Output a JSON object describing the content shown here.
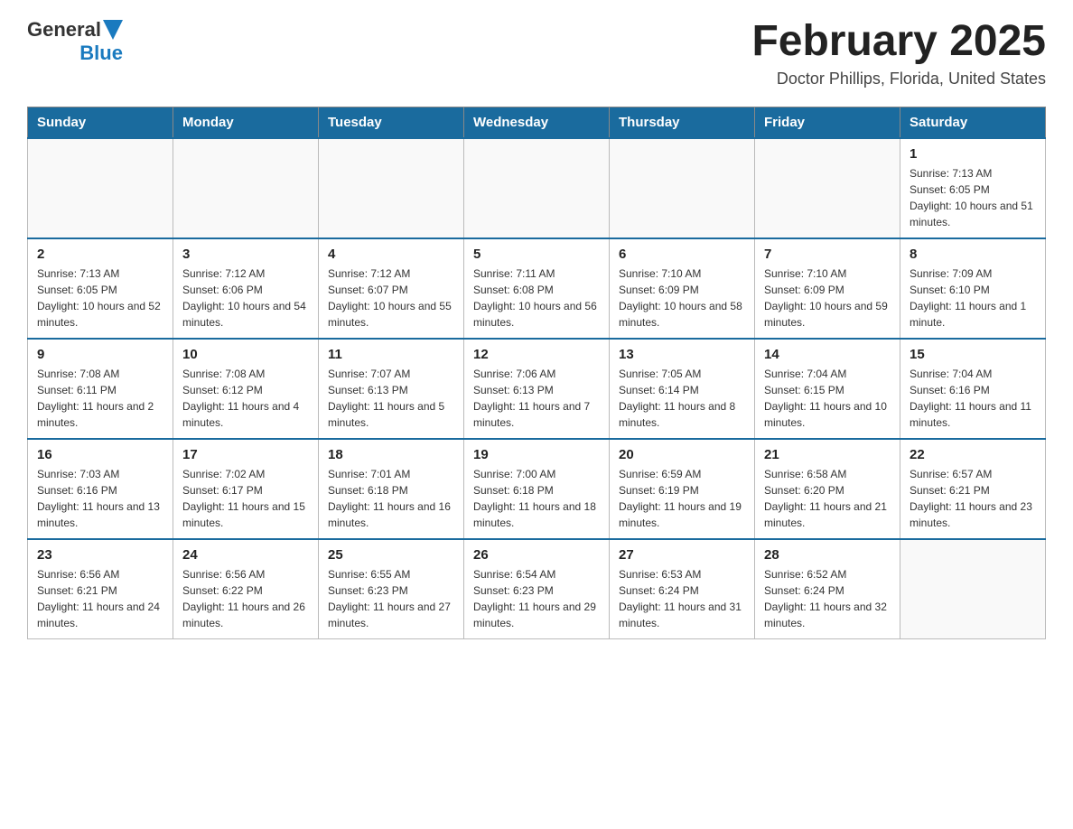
{
  "logo": {
    "general": "General",
    "blue": "Blue"
  },
  "header": {
    "month": "February 2025",
    "location": "Doctor Phillips, Florida, United States"
  },
  "weekdays": [
    "Sunday",
    "Monday",
    "Tuesday",
    "Wednesday",
    "Thursday",
    "Friday",
    "Saturday"
  ],
  "weeks": [
    [
      {
        "day": "",
        "sunrise": "",
        "sunset": "",
        "daylight": ""
      },
      {
        "day": "",
        "sunrise": "",
        "sunset": "",
        "daylight": ""
      },
      {
        "day": "",
        "sunrise": "",
        "sunset": "",
        "daylight": ""
      },
      {
        "day": "",
        "sunrise": "",
        "sunset": "",
        "daylight": ""
      },
      {
        "day": "",
        "sunrise": "",
        "sunset": "",
        "daylight": ""
      },
      {
        "day": "",
        "sunrise": "",
        "sunset": "",
        "daylight": ""
      },
      {
        "day": "1",
        "sunrise": "Sunrise: 7:13 AM",
        "sunset": "Sunset: 6:05 PM",
        "daylight": "Daylight: 10 hours and 51 minutes."
      }
    ],
    [
      {
        "day": "2",
        "sunrise": "Sunrise: 7:13 AM",
        "sunset": "Sunset: 6:05 PM",
        "daylight": "Daylight: 10 hours and 52 minutes."
      },
      {
        "day": "3",
        "sunrise": "Sunrise: 7:12 AM",
        "sunset": "Sunset: 6:06 PM",
        "daylight": "Daylight: 10 hours and 54 minutes."
      },
      {
        "day": "4",
        "sunrise": "Sunrise: 7:12 AM",
        "sunset": "Sunset: 6:07 PM",
        "daylight": "Daylight: 10 hours and 55 minutes."
      },
      {
        "day": "5",
        "sunrise": "Sunrise: 7:11 AM",
        "sunset": "Sunset: 6:08 PM",
        "daylight": "Daylight: 10 hours and 56 minutes."
      },
      {
        "day": "6",
        "sunrise": "Sunrise: 7:10 AM",
        "sunset": "Sunset: 6:09 PM",
        "daylight": "Daylight: 10 hours and 58 minutes."
      },
      {
        "day": "7",
        "sunrise": "Sunrise: 7:10 AM",
        "sunset": "Sunset: 6:09 PM",
        "daylight": "Daylight: 10 hours and 59 minutes."
      },
      {
        "day": "8",
        "sunrise": "Sunrise: 7:09 AM",
        "sunset": "Sunset: 6:10 PM",
        "daylight": "Daylight: 11 hours and 1 minute."
      }
    ],
    [
      {
        "day": "9",
        "sunrise": "Sunrise: 7:08 AM",
        "sunset": "Sunset: 6:11 PM",
        "daylight": "Daylight: 11 hours and 2 minutes."
      },
      {
        "day": "10",
        "sunrise": "Sunrise: 7:08 AM",
        "sunset": "Sunset: 6:12 PM",
        "daylight": "Daylight: 11 hours and 4 minutes."
      },
      {
        "day": "11",
        "sunrise": "Sunrise: 7:07 AM",
        "sunset": "Sunset: 6:13 PM",
        "daylight": "Daylight: 11 hours and 5 minutes."
      },
      {
        "day": "12",
        "sunrise": "Sunrise: 7:06 AM",
        "sunset": "Sunset: 6:13 PM",
        "daylight": "Daylight: 11 hours and 7 minutes."
      },
      {
        "day": "13",
        "sunrise": "Sunrise: 7:05 AM",
        "sunset": "Sunset: 6:14 PM",
        "daylight": "Daylight: 11 hours and 8 minutes."
      },
      {
        "day": "14",
        "sunrise": "Sunrise: 7:04 AM",
        "sunset": "Sunset: 6:15 PM",
        "daylight": "Daylight: 11 hours and 10 minutes."
      },
      {
        "day": "15",
        "sunrise": "Sunrise: 7:04 AM",
        "sunset": "Sunset: 6:16 PM",
        "daylight": "Daylight: 11 hours and 11 minutes."
      }
    ],
    [
      {
        "day": "16",
        "sunrise": "Sunrise: 7:03 AM",
        "sunset": "Sunset: 6:16 PM",
        "daylight": "Daylight: 11 hours and 13 minutes."
      },
      {
        "day": "17",
        "sunrise": "Sunrise: 7:02 AM",
        "sunset": "Sunset: 6:17 PM",
        "daylight": "Daylight: 11 hours and 15 minutes."
      },
      {
        "day": "18",
        "sunrise": "Sunrise: 7:01 AM",
        "sunset": "Sunset: 6:18 PM",
        "daylight": "Daylight: 11 hours and 16 minutes."
      },
      {
        "day": "19",
        "sunrise": "Sunrise: 7:00 AM",
        "sunset": "Sunset: 6:18 PM",
        "daylight": "Daylight: 11 hours and 18 minutes."
      },
      {
        "day": "20",
        "sunrise": "Sunrise: 6:59 AM",
        "sunset": "Sunset: 6:19 PM",
        "daylight": "Daylight: 11 hours and 19 minutes."
      },
      {
        "day": "21",
        "sunrise": "Sunrise: 6:58 AM",
        "sunset": "Sunset: 6:20 PM",
        "daylight": "Daylight: 11 hours and 21 minutes."
      },
      {
        "day": "22",
        "sunrise": "Sunrise: 6:57 AM",
        "sunset": "Sunset: 6:21 PM",
        "daylight": "Daylight: 11 hours and 23 minutes."
      }
    ],
    [
      {
        "day": "23",
        "sunrise": "Sunrise: 6:56 AM",
        "sunset": "Sunset: 6:21 PM",
        "daylight": "Daylight: 11 hours and 24 minutes."
      },
      {
        "day": "24",
        "sunrise": "Sunrise: 6:56 AM",
        "sunset": "Sunset: 6:22 PM",
        "daylight": "Daylight: 11 hours and 26 minutes."
      },
      {
        "day": "25",
        "sunrise": "Sunrise: 6:55 AM",
        "sunset": "Sunset: 6:23 PM",
        "daylight": "Daylight: 11 hours and 27 minutes."
      },
      {
        "day": "26",
        "sunrise": "Sunrise: 6:54 AM",
        "sunset": "Sunset: 6:23 PM",
        "daylight": "Daylight: 11 hours and 29 minutes."
      },
      {
        "day": "27",
        "sunrise": "Sunrise: 6:53 AM",
        "sunset": "Sunset: 6:24 PM",
        "daylight": "Daylight: 11 hours and 31 minutes."
      },
      {
        "day": "28",
        "sunrise": "Sunrise: 6:52 AM",
        "sunset": "Sunset: 6:24 PM",
        "daylight": "Daylight: 11 hours and 32 minutes."
      },
      {
        "day": "",
        "sunrise": "",
        "sunset": "",
        "daylight": ""
      }
    ]
  ]
}
